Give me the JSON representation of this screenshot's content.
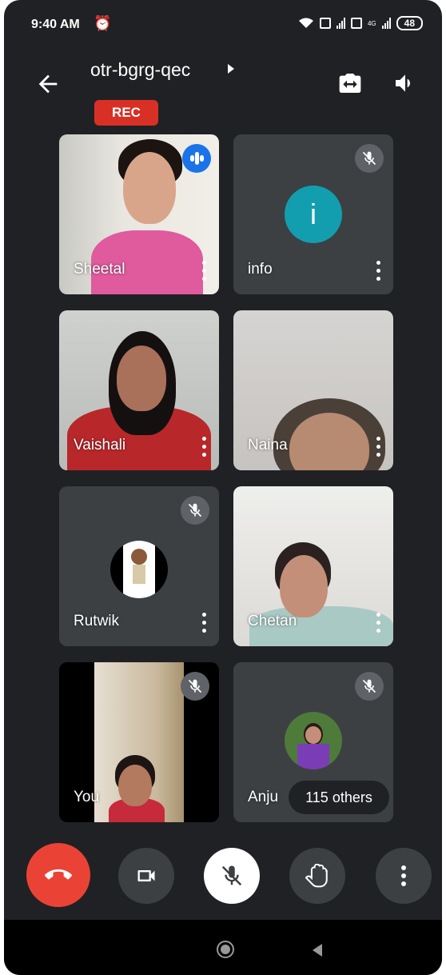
{
  "status_bar": {
    "time": "9:40 AM",
    "battery": "48",
    "sim1_tag": "VoLTE",
    "sim2_tag": "4G",
    "icons": [
      "alarm-icon",
      "wifi-icon",
      "signal-icon",
      "battery-icon"
    ]
  },
  "header": {
    "meeting_code": "otr-bgrg-qec",
    "rec_label": "REC",
    "icons": [
      "back-arrow-icon",
      "switch-camera-icon",
      "speaker-icon"
    ]
  },
  "participants": [
    {
      "name": "Sheetal",
      "muted": false,
      "speaking": true
    },
    {
      "name": "info",
      "muted": true,
      "avatar_letter": "i",
      "avatar_color": "#129eaf"
    },
    {
      "name": "Vaishali",
      "muted": false
    },
    {
      "name": "Naina",
      "muted": false
    },
    {
      "name": "Rutwik",
      "muted": true
    },
    {
      "name": "Chetan",
      "muted": false
    },
    {
      "name": "You",
      "muted": true
    },
    {
      "name": "Anju",
      "muted": true
    }
  ],
  "others_label": "115 others",
  "controls": {
    "icons": [
      "end-call-icon",
      "camera-icon",
      "mic-off-icon",
      "raise-hand-icon",
      "more-options-icon"
    ],
    "end_call_color": "#ea4335"
  }
}
